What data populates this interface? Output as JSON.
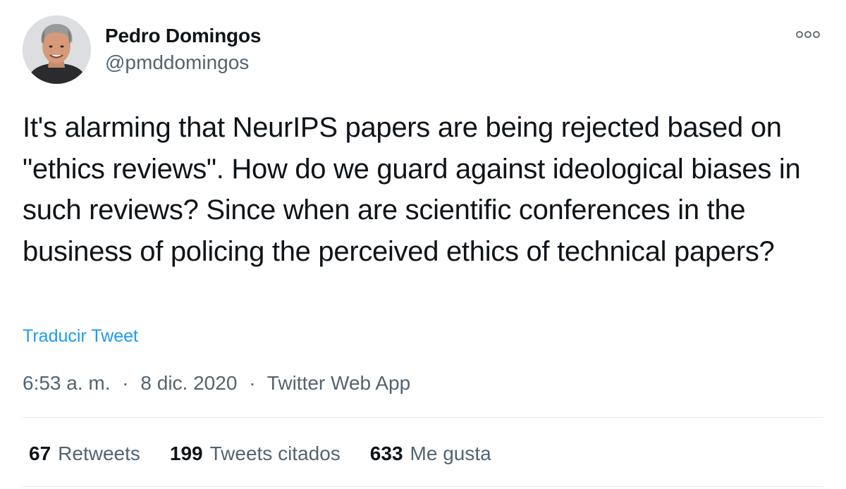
{
  "author": {
    "name": "Pedro Domingos",
    "handle": "@pmddomingos"
  },
  "tweet": {
    "text": "It's alarming that NeurIPS papers are being rejected based on \"ethics reviews\". How do we guard against ideological biases in such reviews? Since when are scientific conferences in the business of policing the perceived ethics of technical papers?",
    "translate_label": "Traducir Tweet",
    "time": "6:53 a. m.",
    "date": "8 dic. 2020",
    "source": "Twitter Web App",
    "separator": "·"
  },
  "stats": {
    "retweets": {
      "count": "67",
      "label": "Retweets"
    },
    "quotes": {
      "count": "199",
      "label": "Tweets citados"
    },
    "likes": {
      "count": "633",
      "label": "Me gusta"
    }
  },
  "colors": {
    "link": "#1d9bf0",
    "secondary_text": "#536471",
    "primary_text": "#0f1419",
    "divider": "#e6ecf0"
  },
  "icons": {
    "more": "more-dots-icon",
    "avatar": "profile-photo"
  }
}
